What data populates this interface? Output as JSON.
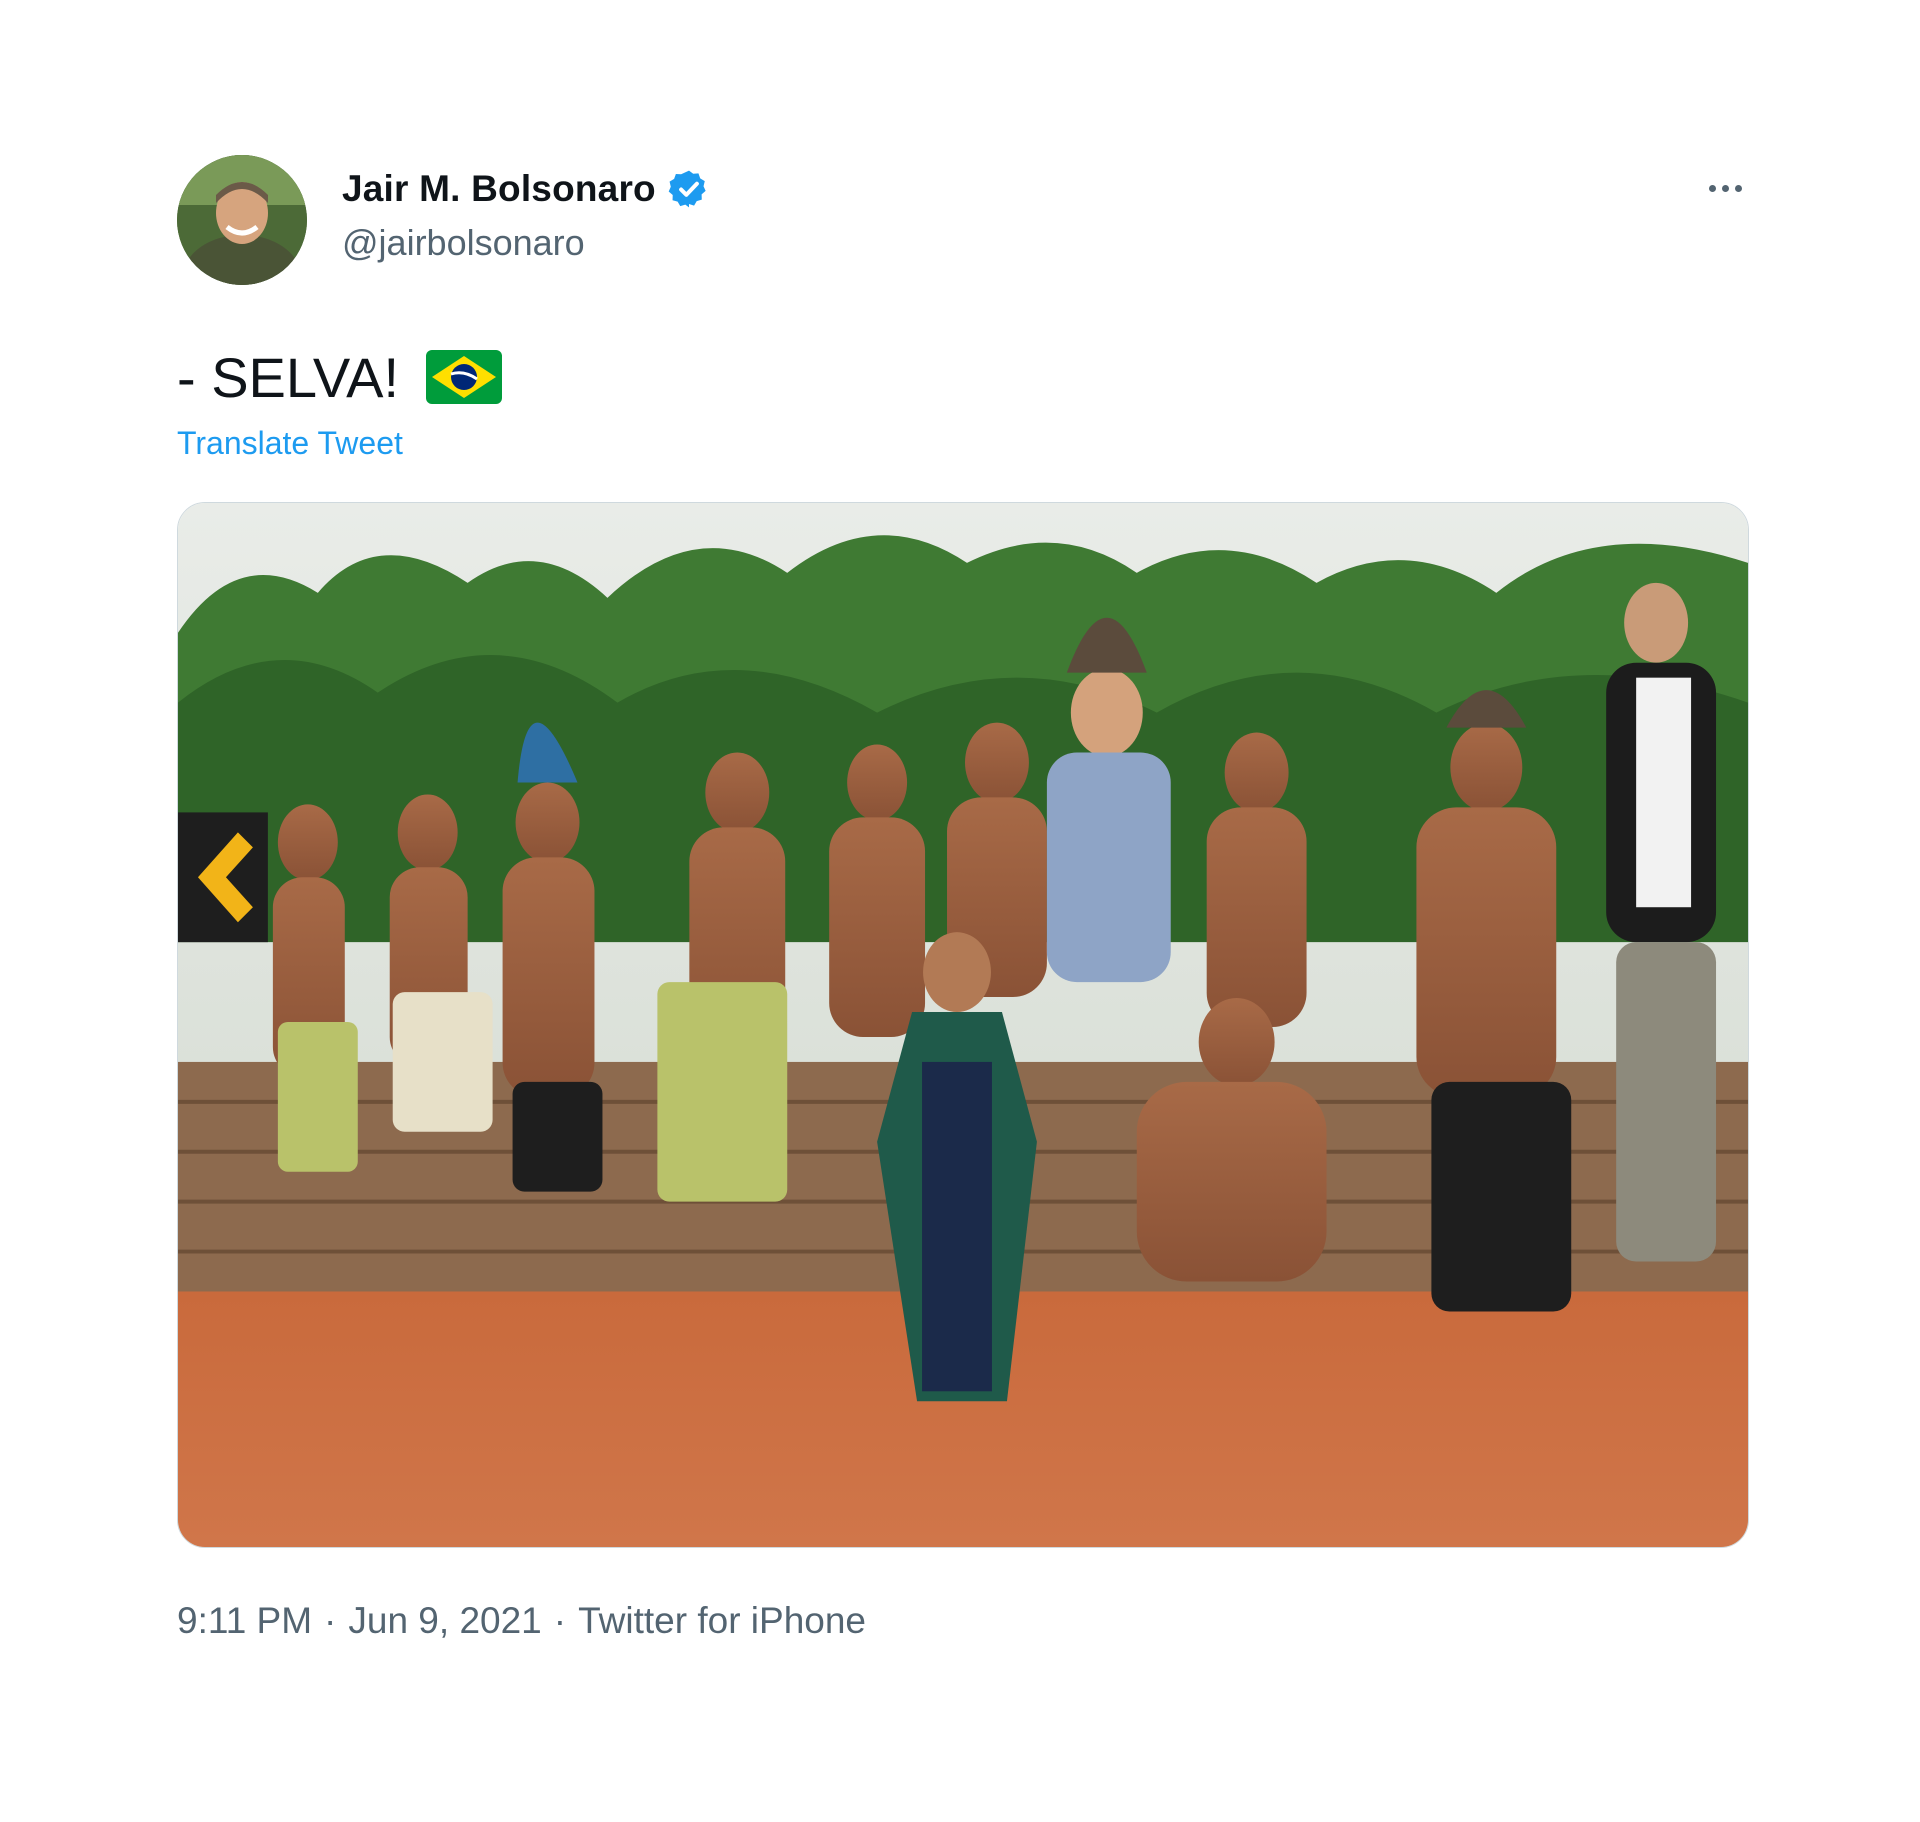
{
  "tweet": {
    "author": {
      "display_name": "Jair M. Bolsonaro",
      "handle": "@jairbolsonaro",
      "verified": true,
      "avatar_icon": "profile-photo"
    },
    "text": "- SELVA!",
    "emoji": "flag-brazil",
    "translate_label": "Translate Tweet",
    "media": {
      "kind": "photo",
      "chevron_sign_icon": "chevron-left-icon"
    },
    "time": "9:11 PM",
    "separator": "·",
    "date": "Jun 9, 2021",
    "source": "Twitter for iPhone"
  },
  "colors": {
    "text_primary": "#0f1419",
    "text_secondary": "#536471",
    "link_blue": "#1d9bf0",
    "verified_blue": "#1d9bf0",
    "flag_green": "#009c3b",
    "flag_yellow": "#ffdf00",
    "flag_blue": "#002776"
  }
}
